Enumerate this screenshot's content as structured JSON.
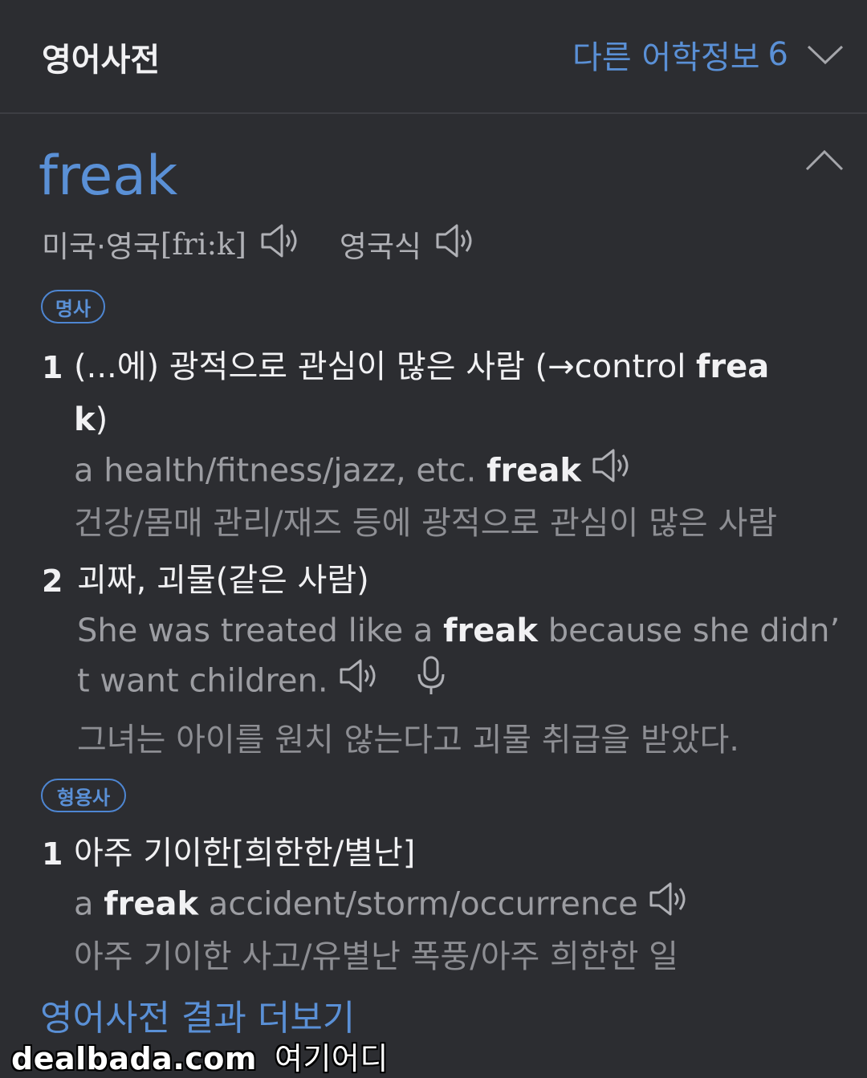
{
  "header": {
    "title": "영어사전",
    "more_label": "다른 어학정보",
    "more_count": "6"
  },
  "entry": {
    "word": "freak",
    "pron_region": "미국·영국",
    "ipa": "[fri:k]",
    "uk_label": "영국식"
  },
  "noun": {
    "pos_label": "명사",
    "senses": [
      {
        "num": "1",
        "meaning_1": "(...에) 광적으로 관심이 많은 사람 (→control ",
        "meaning_bold_1": "frea",
        "meaning_bold_2": "k",
        "meaning_2": ")",
        "ex_pre": "a health/fitness/jazz, etc. ",
        "ex_bold": "freak",
        "translation": "건강/몸매 관리/재즈 등에 광적으로 관심이 많은 사람"
      },
      {
        "num": "2",
        "meaning": "괴짜, 괴물(같은 사람)",
        "ex_pre": "She was treated like a ",
        "ex_bold": "freak",
        "ex_post_1": " because she didn’",
        "ex_post_2": "t want children.",
        "translation": "그녀는 아이를 원치 않는다고 괴물 취급을 받았다."
      }
    ]
  },
  "adjective": {
    "pos_label": "형용사",
    "senses": [
      {
        "num": "1",
        "meaning": "아주 기이한[희한한/별난]",
        "ex_pre": "a ",
        "ex_bold": "freak",
        "ex_post": " accident/storm/occurrence",
        "translation": "아주 기이한 사고/유별난 폭풍/아주 희한한 일"
      }
    ]
  },
  "footer": {
    "more_results": "영어사전 결과 더보기"
  },
  "watermark": {
    "site": "dealbada.com",
    "tag": "여기어디"
  },
  "colors": {
    "background": "#2c2d31",
    "accent": "#5a90d6",
    "text": "#f1f1f3",
    "muted": "#9c9da2"
  },
  "icons": [
    "chevron-down-icon",
    "chevron-up-icon",
    "speaker-icon",
    "microphone-icon"
  ]
}
